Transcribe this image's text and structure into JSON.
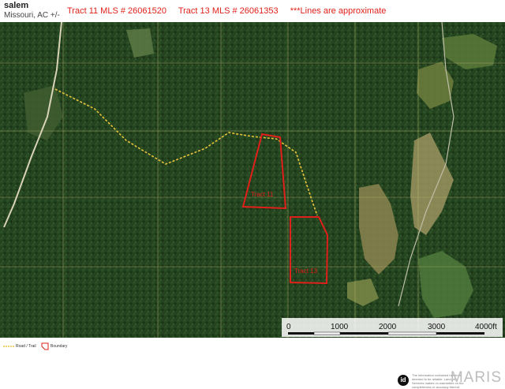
{
  "header": {
    "title": "salem",
    "subtitle": "Missouri, AC +/-",
    "tract11": "Tract 11 MLS # 26061520",
    "tract13": "Tract 13 MLS # 26061353",
    "note": "***Lines are approximate"
  },
  "map": {
    "labels": {
      "tract11": "Tract 11",
      "tract13": "Tract 13"
    },
    "scale_bar": {
      "ticks": [
        "0",
        "1000",
        "2000",
        "3000",
        "4000ft"
      ]
    },
    "colors": {
      "forest": "#1f3d1c",
      "field": "#8a8a4e",
      "road": "#e8c33a",
      "boundary": "#e0201a"
    }
  },
  "legend": {
    "items": [
      "Road / Trail",
      "Boundary"
    ]
  },
  "footer": {
    "logo": "id",
    "disclaimer": "The information contained herein is deemed to be reliable. Land.id® Services makes no warranties on the completeness or accuracy thereof.",
    "brand": "MARIS"
  }
}
